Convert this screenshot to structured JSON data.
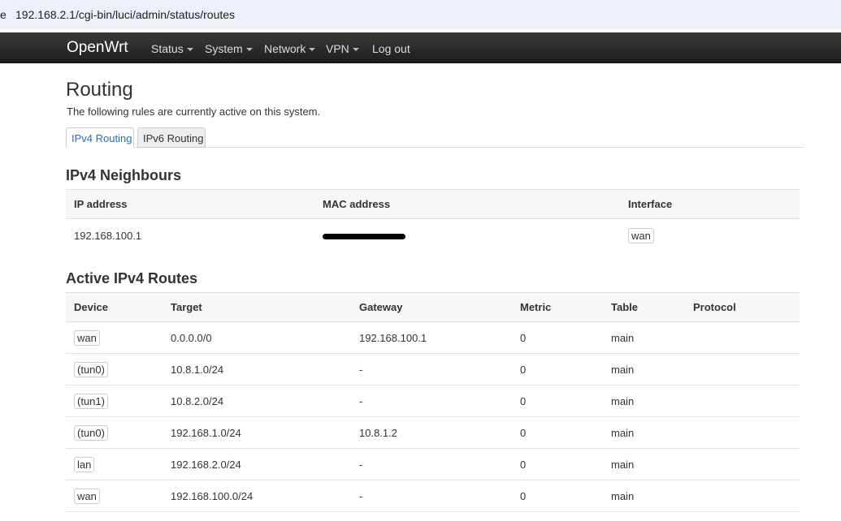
{
  "browser": {
    "prefix": "e",
    "url": "192.168.2.1/cgi-bin/luci/admin/status/routes"
  },
  "navbar": {
    "brand": "OpenWrt",
    "items": [
      {
        "label": "Status",
        "dropdown": true
      },
      {
        "label": "System",
        "dropdown": true
      },
      {
        "label": "Network",
        "dropdown": true
      },
      {
        "label": "VPN",
        "dropdown": true
      },
      {
        "label": "Log out",
        "dropdown": false
      }
    ]
  },
  "page": {
    "title": "Routing",
    "description": "The following rules are currently active on this system.",
    "tabs": [
      {
        "label": "IPv4 Routing",
        "active": true
      },
      {
        "label": "IPv6 Routing",
        "active": false
      }
    ]
  },
  "neighbours": {
    "title": "IPv4 Neighbours",
    "columns": [
      "IP address",
      "MAC address",
      "Interface"
    ],
    "rows": [
      {
        "ip": "192.168.100.1",
        "mac_redacted": true,
        "interface": "wan"
      }
    ]
  },
  "routes": {
    "title": "Active IPv4 Routes",
    "columns": [
      "Device",
      "Target",
      "Gateway",
      "Metric",
      "Table",
      "Protocol"
    ],
    "rows": [
      {
        "device": "wan",
        "target": "0.0.0.0/0",
        "gateway": "192.168.100.1",
        "metric": "0",
        "table": "main",
        "protocol": ""
      },
      {
        "device": "(tun0)",
        "target": "10.8.1.0/24",
        "gateway": "-",
        "metric": "0",
        "table": "main",
        "protocol": ""
      },
      {
        "device": "(tun1)",
        "target": "10.8.2.0/24",
        "gateway": "-",
        "metric": "0",
        "table": "main",
        "protocol": ""
      },
      {
        "device": "(tun0)",
        "target": "192.168.1.0/24",
        "gateway": "10.8.1.2",
        "metric": "0",
        "table": "main",
        "protocol": ""
      },
      {
        "device": "lan",
        "target": "192.168.2.0/24",
        "gateway": "-",
        "metric": "0",
        "table": "main",
        "protocol": ""
      },
      {
        "device": "wan",
        "target": "192.168.100.0/24",
        "gateway": "-",
        "metric": "0",
        "table": "main",
        "protocol": ""
      }
    ]
  },
  "colors": {
    "navbar_bg": "#262626",
    "tab_active_text": "#2a6fb6"
  }
}
